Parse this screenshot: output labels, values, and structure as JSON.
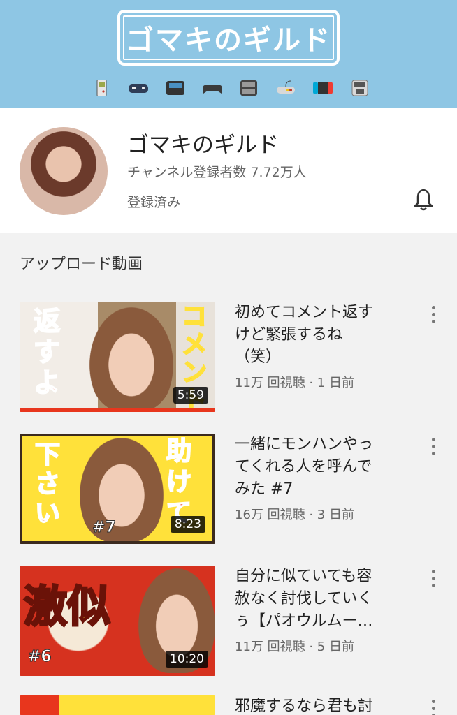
{
  "banner": {
    "logo_text": "ゴマキのギルド",
    "consoles": [
      "gameboy-icon",
      "controller-icon",
      "handheld-icon",
      "gamepad-icon",
      "ds-icon",
      "joypad-icon",
      "switch-icon",
      "3ds-icon"
    ]
  },
  "channel": {
    "name": "ゴマキのギルド",
    "subscribers": "チャンネル登録者数 7.72万人",
    "subscribed_label": "登録済み"
  },
  "section": {
    "title": "アップロード動画"
  },
  "videos": [
    {
      "title_lines": [
        "初めてコメント返す",
        "けど緊張するね",
        "（笑）"
      ],
      "meta": "11万 回視聴 · 1 日前",
      "duration": "5:59",
      "thumb_text_left": "返すよ",
      "thumb_text_right": "コメント"
    },
    {
      "title_lines": [
        "一緒にモンハンやっ",
        "てくれる人を呼んで",
        "みた #7"
      ],
      "meta": "16万 回視聴 · 3 日前",
      "duration": "8:23",
      "thumb_text_left": "下さい",
      "thumb_text_right": "助けて",
      "thumb_tag": "#7"
    },
    {
      "title_lines": [
        "自分に似ていても容",
        "赦なく討伐していく",
        "ぅ【パオウルムー…"
      ],
      "meta": "11万 回視聴 · 5 日前",
      "duration": "10:20",
      "thumb_text_left": "激似",
      "thumb_tag": "#6"
    },
    {
      "title_lines": [
        "邪魔するなら君も討"
      ]
    }
  ],
  "colors": {
    "banner_bg": "#8ec6e4",
    "accent_red": "#e8361d",
    "thumb_yellow": "#ffe13a"
  }
}
